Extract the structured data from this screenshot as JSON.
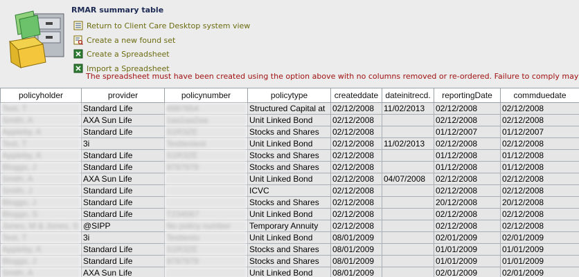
{
  "page": {
    "title": "RMAR summary table"
  },
  "actions": [
    {
      "label": "Return to Client Care Desktop system view",
      "icon": "list-icon"
    },
    {
      "label": "Create a new found set",
      "icon": "search-list-icon"
    },
    {
      "label": "Create a Spreadsheet",
      "icon": "spreadsheet-icon"
    },
    {
      "label": "Import a Spreadsheet",
      "icon": "spreadsheet-icon"
    }
  ],
  "warning": "The spreadsheet must have been created using the option above with no columns removed or re-ordered. Failure to comply may",
  "table": {
    "columns": [
      "policyholder",
      "provider",
      "policynumber",
      "policytype",
      "createddate",
      "dateinitrecd.",
      "reportingDate",
      "commduedate"
    ],
    "rows": [
      {
        "policyholder": "Test, T",
        "provider": "Standard Life",
        "policynumber": "4987654",
        "policytype": "Structured Capital at",
        "createddate": "02/12/2008",
        "dateinitrecd": "11/02/2013",
        "reportingDate": "02/12/2008",
        "commduedate": "02/12/2008"
      },
      {
        "policyholder": "Smith, A",
        "provider": "AXA Sun Life",
        "policynumber": "1aa1aa2aa",
        "policytype": "Unit Linked Bond",
        "createddate": "02/12/2008",
        "dateinitrecd": "",
        "reportingDate": "02/12/2008",
        "commduedate": "02/12/2008"
      },
      {
        "policyholder": "Appleby, A",
        "provider": "Standard Life",
        "policynumber": "S1R3ZE",
        "policytype": "Stocks and Shares",
        "createddate": "02/12/2008",
        "dateinitrecd": "",
        "reportingDate": "01/12/2007",
        "commduedate": "01/12/2007"
      },
      {
        "policyholder": "Test, T",
        "provider": "3i",
        "policynumber": "Testtestest",
        "policytype": "Unit Linked Bond",
        "createddate": "02/12/2008",
        "dateinitrecd": "11/02/2013",
        "reportingDate": "02/12/2008",
        "commduedate": "02/12/2008"
      },
      {
        "policyholder": "Appleby, A",
        "provider": "Standard Life",
        "policynumber": "S1R3ZE",
        "policytype": "Stocks and Shares",
        "createddate": "02/12/2008",
        "dateinitrecd": "",
        "reportingDate": "01/12/2008",
        "commduedate": "01/12/2008"
      },
      {
        "policyholder": "Bloggs, J",
        "provider": "Standard Life",
        "policynumber": "9797979",
        "policytype": "Stocks and Shares",
        "createddate": "02/12/2008",
        "dateinitrecd": "",
        "reportingDate": "01/12/2008",
        "commduedate": "01/12/2008"
      },
      {
        "policyholder": "Smith, A",
        "provider": "AXA Sun Life",
        "policynumber": "",
        "policytype": "Unit Linked Bond",
        "createddate": "02/12/2008",
        "dateinitrecd": "04/07/2008",
        "reportingDate": "02/12/2008",
        "commduedate": "02/12/2008"
      },
      {
        "policyholder": "Smith, J",
        "provider": "Standard Life",
        "policynumber": "",
        "policytype": "ICVC",
        "createddate": "02/12/2008",
        "dateinitrecd": "",
        "reportingDate": "02/12/2008",
        "commduedate": "02/12/2008"
      },
      {
        "policyholder": "Bloggs, J",
        "provider": "Standard Life",
        "policynumber": "",
        "policytype": "Stocks and Shares",
        "createddate": "02/12/2008",
        "dateinitrecd": "",
        "reportingDate": "20/12/2008",
        "commduedate": "20/12/2008"
      },
      {
        "policyholder": "Bloggs, S",
        "provider": "Standard Life",
        "policynumber": "T234567",
        "policytype": "Unit Linked Bond",
        "createddate": "02/12/2008",
        "dateinitrecd": "",
        "reportingDate": "02/12/2008",
        "commduedate": "02/12/2008"
      },
      {
        "policyholder": "Jones, M & Jones, S",
        "provider": "@SIPP",
        "policynumber": "No policy number",
        "policytype": "Temporary Annuity",
        "createddate": "02/12/2008",
        "dateinitrecd": "",
        "reportingDate": "02/12/2008",
        "commduedate": "02/12/2008"
      },
      {
        "policyholder": "Test, T",
        "provider": "3i",
        "policynumber": "Testtesto",
        "policytype": "Unit Linked Bond",
        "createddate": "08/01/2009",
        "dateinitrecd": "",
        "reportingDate": "02/01/2009",
        "commduedate": "02/01/2009"
      },
      {
        "policyholder": "Appleby, A",
        "provider": "Standard Life",
        "policynumber": "S1R3ZE",
        "policytype": "Stocks and Shares",
        "createddate": "08/01/2009",
        "dateinitrecd": "",
        "reportingDate": "01/01/2009",
        "commduedate": "01/01/2009"
      },
      {
        "policyholder": "Bloggs, J",
        "provider": "Standard Life",
        "policynumber": "9797979",
        "policytype": "Stocks and Shares",
        "createddate": "08/01/2009",
        "dateinitrecd": "",
        "reportingDate": "01/01/2009",
        "commduedate": "01/01/2009"
      },
      {
        "policyholder": "Smith, A",
        "provider": "AXA Sun Life",
        "policynumber": "",
        "policytype": "Unit Linked Bond",
        "createddate": "08/01/2009",
        "dateinitrecd": "",
        "reportingDate": "02/01/2009",
        "commduedate": "02/01/2009"
      }
    ]
  },
  "colors": {
    "title": "#1c2a54",
    "link": "#6b6b10",
    "warning": "#a01010",
    "cell": "#e6e6e6"
  }
}
